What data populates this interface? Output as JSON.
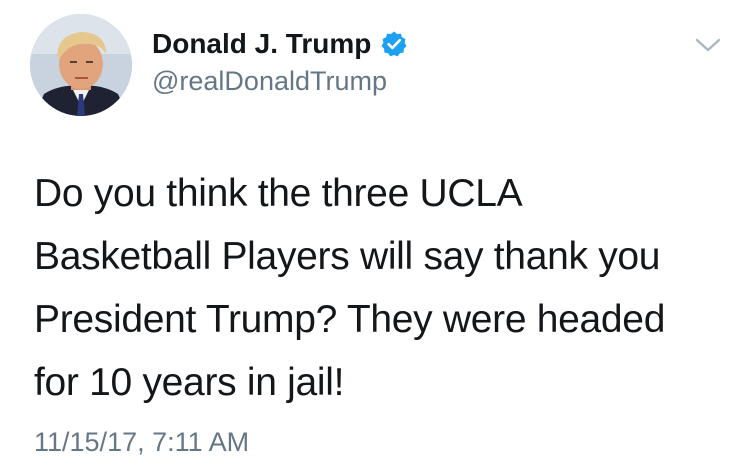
{
  "author": {
    "display_name": "Donald J. Trump",
    "handle": "@realDonaldTrump",
    "avatar_icon": "profile-photo",
    "verified_icon": "verified-badge-icon",
    "verified_color": "#1da1f2"
  },
  "menu": {
    "caret_icon": "chevron-down-icon",
    "caret_color": "#aab8c2"
  },
  "tweet": {
    "lines": [
      "Do you think the three UCLA",
      "Basketball Players will say thank you",
      "President Trump? They were headed",
      "for 10 years in jail!"
    ],
    "timestamp": "11/15/17, 7:11 AM"
  },
  "colors": {
    "text": "#14171a",
    "secondary": "#657786"
  }
}
